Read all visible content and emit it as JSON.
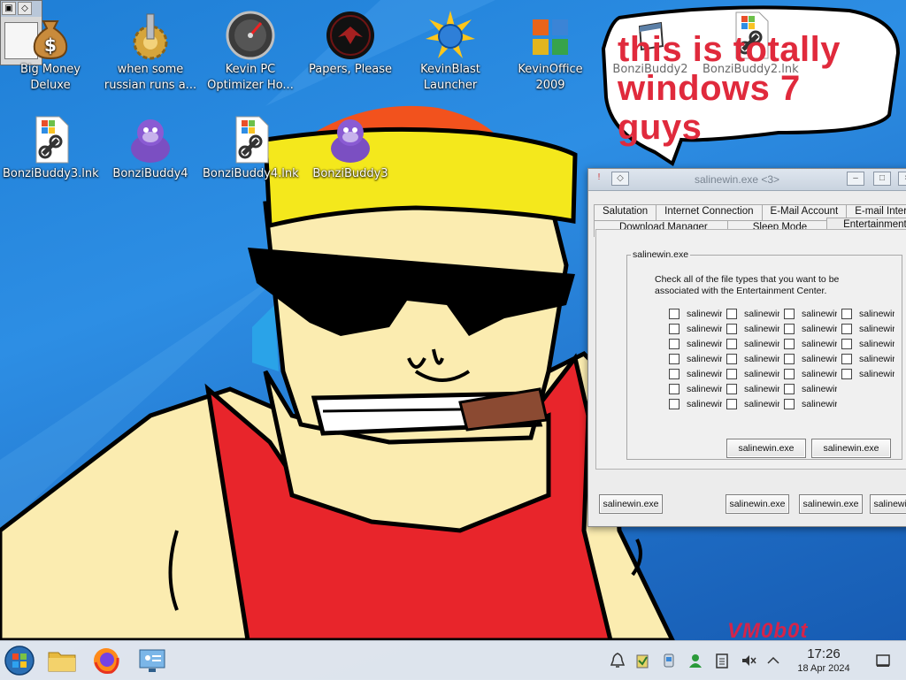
{
  "desktop": {
    "icons": [
      {
        "label": "Big Money Deluxe",
        "icon": "money-bag-icon"
      },
      {
        "label": "when some russian runs a...",
        "icon": "gear-tower-icon"
      },
      {
        "label": "Kevin PC Optimizer Ho...",
        "icon": "gauge-icon"
      },
      {
        "label": "Papers, Please",
        "icon": "papers-please-seal-icon"
      },
      {
        "label": "KevinBlast Launcher",
        "icon": "globe-burst-icon"
      },
      {
        "label": "KevinOffice 2009",
        "icon": "office-logo-icon"
      },
      {
        "label": "BonziBuddy2",
        "icon": "folder-window-icon"
      },
      {
        "label": "BonziBuddy2.lnk",
        "icon": "shortcut-file-icon"
      },
      {
        "label": "BonziBuddy3.lnk",
        "icon": "shortcut-file-icon"
      },
      {
        "label": "BonziBuddy4",
        "icon": "purple-gorilla-icon"
      },
      {
        "label": "BonziBuddy4.lnk",
        "icon": "shortcut-file-icon"
      },
      {
        "label": "BonziBuddy3",
        "icon": "purple-gorilla-icon"
      }
    ]
  },
  "wallpaper": {
    "speech_bubble": [
      "this is totally",
      "windows 7 guys"
    ],
    "watermark": "VM0b0t"
  },
  "dialog": {
    "title": "salinewin.exe <3>",
    "tabs_row1": [
      "Salutation",
      "Internet Connection",
      "E-Mail Account",
      "E-mail Inter"
    ],
    "tabs_row2": [
      "Download Manager",
      "Sleep Mode",
      "Entertainment Cente"
    ],
    "group_label": "salinewin.exe",
    "instruction": "Check all of the file types that you want to be associated with the Entertainment Center.",
    "checkbox_label": "salinewir",
    "checkbox_columns": [
      7,
      7,
      7,
      5
    ],
    "inner_buttons": [
      "salinewin.exe",
      "salinewin.exe"
    ],
    "bottom_buttons": [
      "salinewin.exe",
      "salinewin.exe",
      "salinewin.exe",
      "salinewin.exe"
    ]
  },
  "taskbar": {
    "clock_time": "17:26",
    "clock_date": "18 Apr 2024"
  },
  "colors": {
    "desktop_blue": "#1f7fd6",
    "bubble_text": "#e02a3c",
    "watermark": "#d4244a",
    "bandana_yellow": "#f4e81c",
    "tank_top_red": "#e8252b",
    "skin": "#fbecb0"
  }
}
